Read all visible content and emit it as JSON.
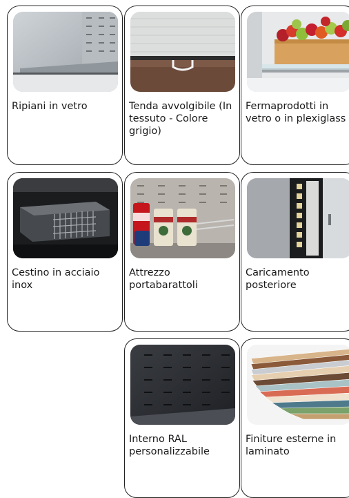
{
  "cards": [
    {
      "name": "glass-shelves",
      "label": "Ripiani in vetro"
    },
    {
      "name": "roller-blind",
      "label": "Tenda avvolgibile (In tessuto - Colore grigio)"
    },
    {
      "name": "product-stoppers",
      "label": "Fermaprodotti in vetro o in plexiglass"
    },
    {
      "name": "stainless-basket",
      "label": "Cestino in acciaio inox"
    },
    {
      "name": "can-holder",
      "label": "Attrezzo portabarattoli"
    },
    {
      "name": "rear-loading",
      "label": "Caricamento posteriore"
    },
    {
      "name": "ral-interior",
      "label": "Interno RAL personalizzabile"
    },
    {
      "name": "laminate-finishes",
      "label": "Finiture esterne in laminato"
    }
  ]
}
